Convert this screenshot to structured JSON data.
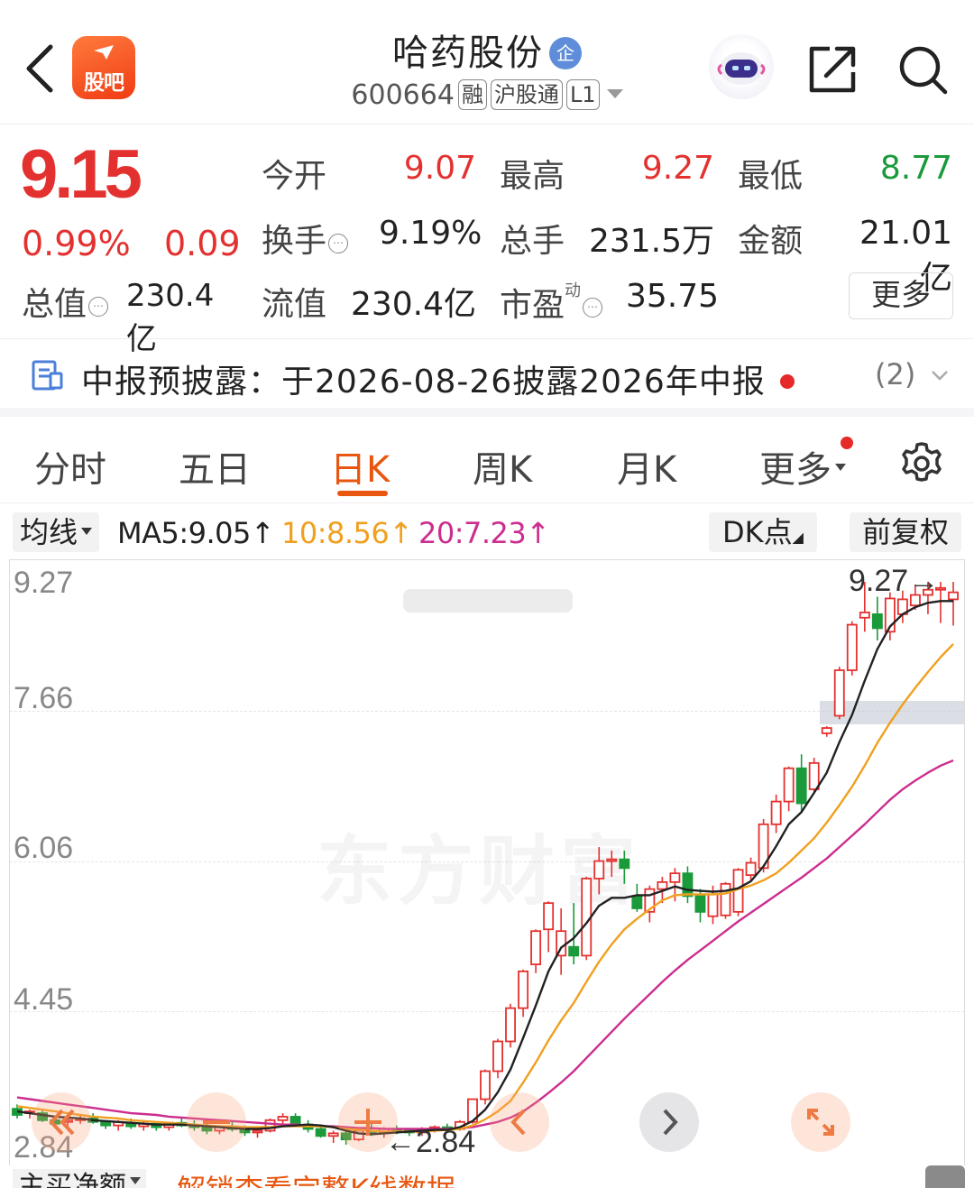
{
  "header": {
    "app_logo_text": "股吧",
    "stock_name": "哈药股份",
    "enterprise_badge": "企",
    "stock_code": "600664",
    "tags": [
      "融",
      "沪股通",
      "L1"
    ]
  },
  "quote": {
    "price": "9.15",
    "change_pct": "0.99%",
    "change": "0.09",
    "open_label": "今开",
    "open": "9.07",
    "high_label": "最高",
    "high": "9.27",
    "low_label": "最低",
    "low": "8.77",
    "turnover_label": "换手",
    "turnover": "9.19%",
    "volume_label": "总手",
    "volume": "231.5万",
    "amount_label": "金额",
    "amount": "21.01亿",
    "mktcap_label": "总值",
    "mktcap": "230.4亿",
    "float_label": "流值",
    "float": "230.4亿",
    "pe_label": "市盈",
    "pe_sup": "动",
    "pe": "35.75",
    "more_label": "更多"
  },
  "notice": {
    "text": "中报预披露：于2026-08-26披露2026年中报",
    "count": "(2)"
  },
  "tabs": {
    "items": [
      "分时",
      "五日",
      "日K",
      "周K",
      "月K",
      "更多"
    ],
    "active_index": 2
  },
  "indicators": {
    "select_label": "均线",
    "ma5": "MA5:9.05↑",
    "ma10": "10:8.56↑",
    "ma20": "20:7.23↑",
    "dk_label": "DK点",
    "restore_label": "前复权",
    "colors": {
      "ma5": "#222222",
      "ma10": "#f0a020",
      "ma20": "#cc2d8f",
      "up": "#e3312f",
      "down": "#1a9a3a",
      "accent": "#e8560f"
    }
  },
  "chart": {
    "y_labels": [
      "9.27",
      "7.66",
      "6.06",
      "4.45",
      "2.84"
    ],
    "high_marker": "9.27",
    "low_marker": "2.84",
    "watermark": "东方财富"
  },
  "chart_data": {
    "type": "candlestick",
    "ylim": [
      2.84,
      9.27
    ],
    "y_ticks": [
      9.27,
      7.66,
      6.06,
      4.45,
      2.84
    ],
    "candles_ohlc": [
      [
        3.25,
        3.3,
        3.14,
        3.18
      ],
      [
        3.2,
        3.24,
        3.14,
        3.22
      ],
      [
        3.2,
        3.23,
        3.1,
        3.12
      ],
      [
        3.12,
        3.15,
        3.04,
        3.08
      ],
      [
        3.1,
        3.15,
        3.05,
        3.12
      ],
      [
        3.12,
        3.18,
        3.08,
        3.14
      ],
      [
        3.14,
        3.2,
        3.08,
        3.1
      ],
      [
        3.1,
        3.12,
        3.02,
        3.06
      ],
      [
        3.06,
        3.12,
        3.0,
        3.1
      ],
      [
        3.08,
        3.14,
        3.02,
        3.05
      ],
      [
        3.05,
        3.12,
        3.0,
        3.08
      ],
      [
        3.08,
        3.1,
        3.0,
        3.04
      ],
      [
        3.04,
        3.1,
        3.0,
        3.09
      ],
      [
        3.09,
        3.15,
        3.04,
        3.06
      ],
      [
        3.06,
        3.12,
        3.0,
        3.05
      ],
      [
        3.05,
        3.08,
        2.96,
        3.0
      ],
      [
        3.0,
        3.06,
        2.96,
        3.04
      ],
      [
        3.04,
        3.1,
        2.99,
        3.02
      ],
      [
        3.02,
        3.06,
        2.94,
        2.98
      ],
      [
        2.98,
        3.04,
        2.92,
        3.0
      ],
      [
        3.0,
        3.14,
        2.98,
        3.12
      ],
      [
        3.12,
        3.2,
        3.06,
        3.16
      ],
      [
        3.16,
        3.2,
        3.04,
        3.07
      ],
      [
        3.07,
        3.12,
        2.98,
        3.02
      ],
      [
        3.02,
        3.05,
        2.92,
        2.94
      ],
      [
        2.94,
        3.0,
        2.86,
        2.97
      ],
      [
        2.97,
        3.02,
        2.84,
        2.9
      ],
      [
        2.9,
        3.04,
        2.88,
        3.0
      ],
      [
        3.0,
        3.08,
        2.94,
        2.98
      ],
      [
        2.98,
        3.04,
        2.92,
        3.02
      ],
      [
        3.02,
        3.06,
        2.96,
        3.0
      ],
      [
        3.0,
        3.02,
        2.94,
        2.98
      ],
      [
        2.98,
        3.04,
        2.94,
        3.02
      ],
      [
        3.02,
        3.06,
        2.98,
        3.04
      ],
      [
        3.04,
        3.08,
        2.98,
        3.02
      ],
      [
        3.02,
        3.12,
        3.0,
        3.1
      ],
      [
        3.1,
        3.36,
        3.08,
        3.36
      ],
      [
        3.36,
        3.7,
        3.3,
        3.68
      ],
      [
        3.68,
        4.05,
        3.6,
        4.02
      ],
      [
        4.02,
        4.45,
        3.95,
        4.4
      ],
      [
        4.4,
        4.84,
        4.3,
        4.82
      ],
      [
        4.9,
        5.3,
        4.8,
        5.28
      ],
      [
        5.3,
        5.62,
        5.04,
        5.6
      ],
      [
        5.0,
        5.54,
        4.78,
        5.28
      ],
      [
        5.1,
        5.6,
        4.9,
        5.0
      ],
      [
        5.0,
        5.9,
        4.95,
        5.88
      ],
      [
        5.88,
        6.24,
        5.7,
        6.08
      ],
      [
        6.08,
        6.2,
        5.9,
        6.1
      ],
      [
        6.1,
        6.2,
        5.82,
        6.0
      ],
      [
        5.68,
        5.82,
        5.5,
        5.54
      ],
      [
        5.5,
        5.8,
        5.38,
        5.76
      ],
      [
        5.76,
        5.9,
        5.6,
        5.84
      ],
      [
        5.84,
        6.0,
        5.62,
        5.94
      ],
      [
        5.94,
        6.02,
        5.6,
        5.68
      ],
      [
        5.68,
        5.76,
        5.38,
        5.5
      ],
      [
        5.45,
        5.8,
        5.36,
        5.7
      ],
      [
        5.46,
        5.84,
        5.42,
        5.82
      ],
      [
        5.5,
        6.0,
        5.45,
        5.98
      ],
      [
        5.92,
        6.12,
        5.84,
        6.06
      ],
      [
        6.0,
        6.56,
        5.95,
        6.5
      ],
      [
        6.5,
        6.84,
        6.4,
        6.76
      ],
      [
        6.76,
        7.16,
        6.65,
        7.14
      ],
      [
        7.14,
        7.3,
        6.64,
        6.74
      ],
      [
        6.9,
        7.26,
        6.85,
        7.2
      ],
      [
        7.54,
        7.62,
        7.5,
        7.6
      ],
      [
        7.74,
        8.3,
        7.7,
        8.26
      ],
      [
        8.26,
        8.82,
        8.2,
        8.78
      ],
      [
        8.86,
        9.27,
        8.7,
        8.92
      ],
      [
        8.9,
        9.1,
        8.6,
        8.74
      ],
      [
        8.7,
        9.15,
        8.6,
        9.08
      ],
      [
        8.9,
        9.17,
        8.8,
        9.07
      ],
      [
        9.0,
        9.24,
        8.95,
        9.12
      ],
      [
        9.12,
        9.27,
        8.9,
        9.18
      ],
      [
        9.18,
        9.27,
        8.8,
        9.2
      ],
      [
        9.07,
        9.27,
        8.77,
        9.15
      ]
    ],
    "ma5": [
      3.22,
      3.2,
      3.18,
      3.16,
      3.15,
      3.14,
      3.12,
      3.11,
      3.1,
      3.09,
      3.08,
      3.07,
      3.07,
      3.07,
      3.06,
      3.05,
      3.04,
      3.03,
      3.02,
      3.02,
      3.03,
      3.05,
      3.06,
      3.07,
      3.06,
      3.04,
      3.0,
      2.97,
      2.96,
      2.97,
      2.98,
      2.99,
      3.0,
      3.01,
      3.01,
      3.04,
      3.11,
      3.24,
      3.44,
      3.7,
      4.06,
      4.43,
      4.82,
      5.09,
      5.2,
      5.37,
      5.57,
      5.66,
      5.66,
      5.69,
      5.69,
      5.74,
      5.79,
      5.75,
      5.74,
      5.73,
      5.74,
      5.77,
      5.85,
      6.02,
      6.25,
      6.5,
      6.64,
      6.86,
      7.09,
      7.44,
      7.75,
      8.14,
      8.5,
      8.76,
      8.9,
      8.98,
      9.03,
      9.05,
      9.05
    ],
    "ma10": [
      3.28,
      3.26,
      3.24,
      3.22,
      3.2,
      3.18,
      3.16,
      3.15,
      3.14,
      3.12,
      3.11,
      3.1,
      3.09,
      3.08,
      3.07,
      3.06,
      3.05,
      3.05,
      3.04,
      3.04,
      3.04,
      3.05,
      3.05,
      3.05,
      3.05,
      3.04,
      3.02,
      3.01,
      3.0,
      2.99,
      2.99,
      2.99,
      2.99,
      3.0,
      3.01,
      3.02,
      3.06,
      3.13,
      3.22,
      3.34,
      3.55,
      3.78,
      4.03,
      4.26,
      4.46,
      4.7,
      4.93,
      5.13,
      5.3,
      5.42,
      5.53,
      5.63,
      5.69,
      5.7,
      5.7,
      5.7,
      5.71,
      5.76,
      5.8,
      5.86,
      5.94,
      6.06,
      6.2,
      6.34,
      6.52,
      6.72,
      6.93,
      7.17,
      7.43,
      7.66,
      7.87,
      8.06,
      8.24,
      8.41,
      8.56
    ],
    "ma20": [
      3.38,
      3.36,
      3.34,
      3.32,
      3.3,
      3.28,
      3.26,
      3.24,
      3.22,
      3.2,
      3.19,
      3.18,
      3.16,
      3.15,
      3.14,
      3.13,
      3.12,
      3.11,
      3.1,
      3.09,
      3.08,
      3.07,
      3.07,
      3.06,
      3.05,
      3.05,
      3.04,
      3.03,
      3.03,
      3.02,
      3.02,
      3.02,
      3.02,
      3.02,
      3.02,
      3.03,
      3.04,
      3.07,
      3.1,
      3.15,
      3.22,
      3.32,
      3.43,
      3.55,
      3.68,
      3.83,
      3.98,
      4.13,
      4.28,
      4.42,
      4.56,
      4.7,
      4.83,
      4.95,
      5.06,
      5.17,
      5.28,
      5.39,
      5.49,
      5.59,
      5.69,
      5.79,
      5.89,
      6.0,
      6.11,
      6.24,
      6.37,
      6.5,
      6.64,
      6.78,
      6.9,
      7.0,
      7.09,
      7.17,
      7.23
    ]
  },
  "bottom": {
    "flow_select": "主买净额",
    "unlock_link": "解锁查看完整K线数据"
  }
}
